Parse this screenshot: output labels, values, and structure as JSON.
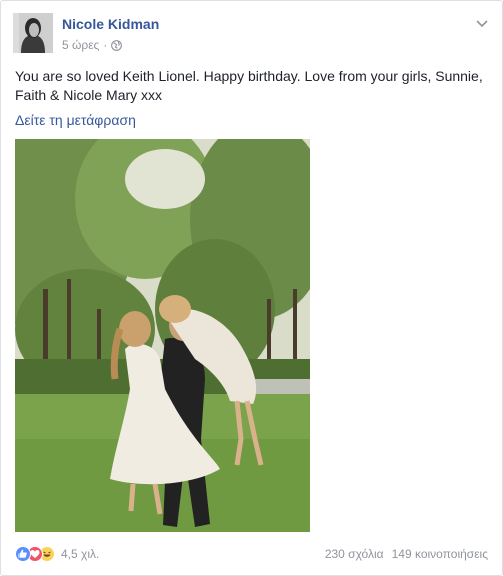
{
  "post": {
    "author": "Nicole Kidman",
    "time": "5 ώρες",
    "separator": "·",
    "privacy_icon": "globe-icon",
    "text": "You are so loved Keith Lionel. Happy birthday. Love from your girls, Sunnie, Faith & Nicole Mary xxx",
    "translate_link": "Δείτε τη μετάφραση",
    "options_icon": "chevron-down-icon"
  },
  "reactions": {
    "icons": [
      "like-icon",
      "love-icon",
      "haha-icon"
    ],
    "count": "4,5 χιλ.",
    "comments": "230 σχόλια",
    "shares": "149 κοινοποιήσεις"
  },
  "colors": {
    "link": "#365899",
    "meta": "#90949c",
    "like": "#5890ff",
    "love": "#f25268",
    "haha": "#fcd25c"
  }
}
